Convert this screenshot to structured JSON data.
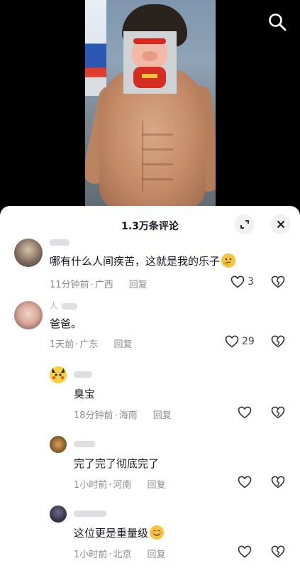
{
  "sheet": {
    "title": "1.3万条评论",
    "expand_icon": "expand-icon",
    "close_icon": "close-icon"
  },
  "colors": {
    "text": "#161823",
    "meta": "#8a8b91",
    "sheet_bg": "#ffffff",
    "accent_emoji": "#f5c43c"
  },
  "comments": [
    {
      "text": "哪有什么人间疾苦，这就是我的乐子",
      "time": "11分钟前",
      "location": "广西",
      "reply": "回复",
      "likes": "3",
      "emoji": "thinking-face-emoji"
    },
    {
      "username": "人",
      "text": "爸爸。",
      "time": "1天前",
      "location": "广东",
      "reply": "回复",
      "likes": "29"
    }
  ],
  "replies": [
    {
      "text": "臭宝",
      "time": "18分钟前",
      "location": "海南",
      "reply": "回复"
    },
    {
      "text": "完了完了彻底完了",
      "time": "1小时前",
      "location": "河南",
      "reply": "回复"
    },
    {
      "text": "这位更是重量级",
      "time": "1小时前",
      "location": "北京",
      "reply": "回复",
      "emoji": "smiling-face-emoji"
    }
  ],
  "dot": "·"
}
